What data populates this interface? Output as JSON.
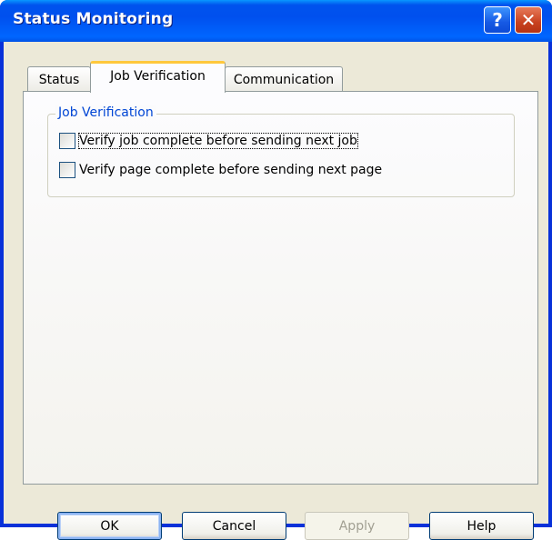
{
  "window": {
    "title": "Status Monitoring",
    "help_glyph": "?",
    "close_glyph": "✕"
  },
  "tabs": [
    {
      "label": "Status",
      "active": false
    },
    {
      "label": "Job Verification",
      "active": true
    },
    {
      "label": "Communication",
      "active": false
    }
  ],
  "group": {
    "label": "Job Verification",
    "options": [
      {
        "label": "Verify job complete before sending next job",
        "checked": false,
        "focused": true
      },
      {
        "label": "Verify page complete before sending next page",
        "checked": false,
        "focused": false
      }
    ]
  },
  "buttons": {
    "ok": "OK",
    "cancel": "Cancel",
    "apply": "Apply",
    "help": "Help"
  },
  "colors": {
    "title_bar": "#0053ee",
    "tab_highlight": "#ffc83c",
    "group_label": "#0046d5"
  }
}
